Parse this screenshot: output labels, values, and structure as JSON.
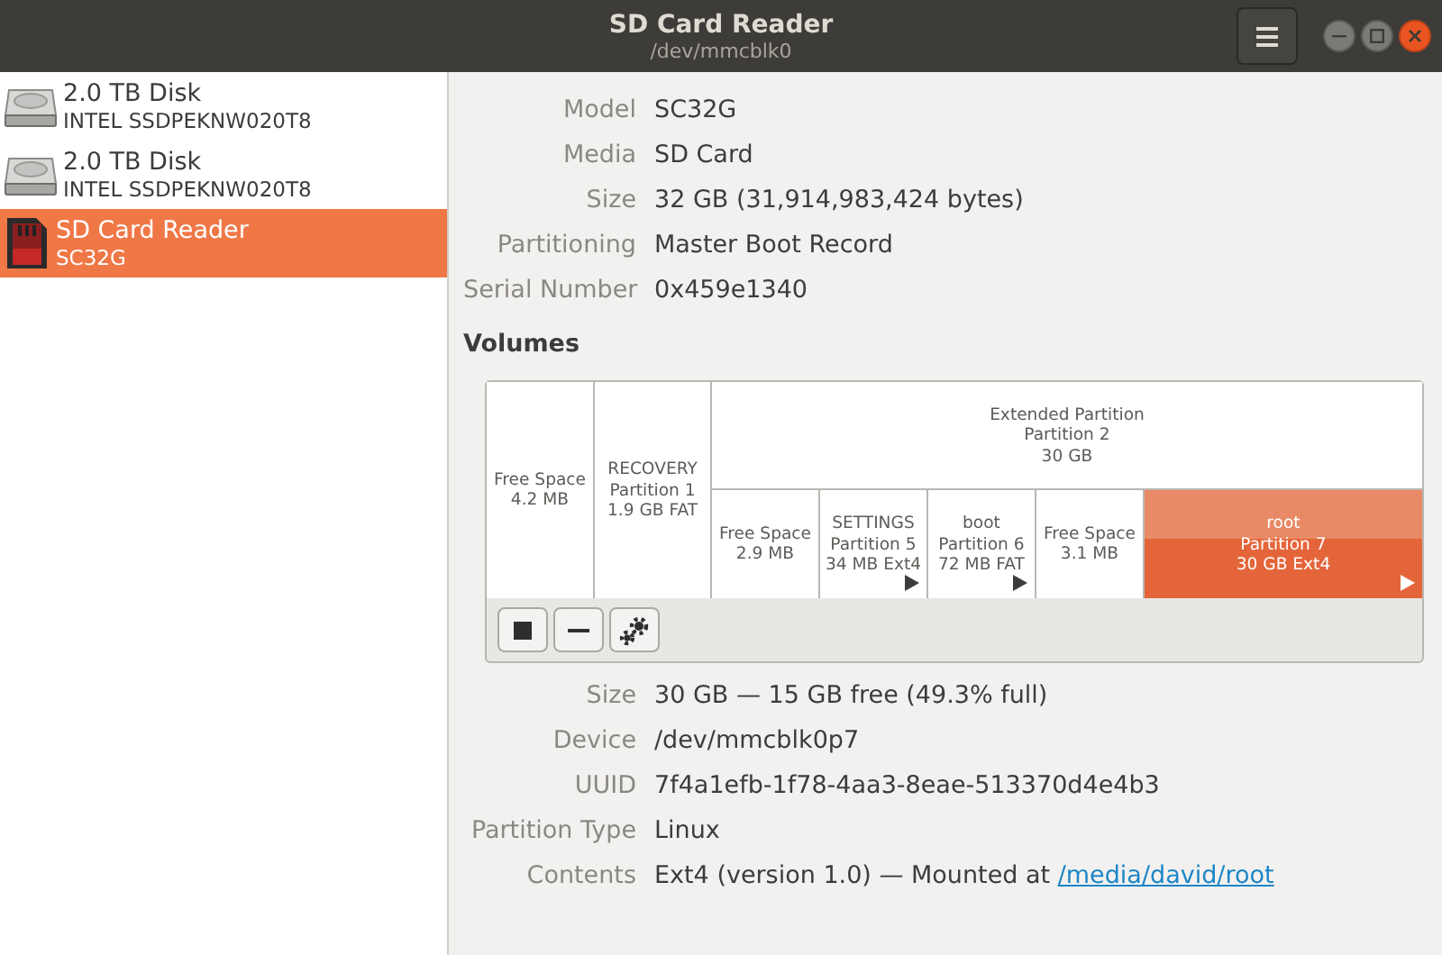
{
  "window": {
    "title": "SD Card Reader",
    "subtitle": "/dev/mmcblk0"
  },
  "drives": [
    {
      "kind": "hdd",
      "name": "2.0 TB Disk",
      "model": "INTEL SSDPEKNW020T8",
      "selected": false
    },
    {
      "kind": "hdd",
      "name": "2.0 TB Disk",
      "model": "INTEL SSDPEKNW020T8",
      "selected": false
    },
    {
      "kind": "sd",
      "name": "SD Card Reader",
      "model": "SC32G",
      "selected": true
    }
  ],
  "drive_details": [
    {
      "label": "Model",
      "value": "SC32G"
    },
    {
      "label": "Media",
      "value": "SD Card"
    },
    {
      "label": "Size",
      "value": "32 GB (31,914,983,424 bytes)"
    },
    {
      "label": "Partitioning",
      "value": "Master Boot Record"
    },
    {
      "label": "Serial Number",
      "value": "0x459e1340"
    }
  ],
  "volumes_heading": "Volumes",
  "volumes": [
    {
      "lines": [
        "Free Space",
        "4.2 MB"
      ],
      "selected": false,
      "mounted": false
    },
    {
      "lines": [
        "RECOVERY",
        "Partition 1",
        "1.9 GB FAT"
      ],
      "selected": false,
      "mounted": false
    },
    {
      "lines": [
        "Extended Partition",
        "Partition 2",
        "30 GB"
      ],
      "selected": false,
      "mounted": false,
      "children": [
        {
          "lines": [
            "Free Space",
            "2.9 MB"
          ],
          "selected": false,
          "mounted": false
        },
        {
          "lines": [
            "SETTINGS",
            "Partition 5",
            "34 MB Ext4"
          ],
          "selected": false,
          "mounted": true
        },
        {
          "lines": [
            "boot",
            "Partition 6",
            "72 MB FAT"
          ],
          "selected": false,
          "mounted": true
        },
        {
          "lines": [
            "Free Space",
            "3.1 MB"
          ],
          "selected": false,
          "mounted": false
        },
        {
          "lines": [
            "root",
            "Partition 7",
            "30 GB Ext4"
          ],
          "selected": true,
          "mounted": true
        }
      ]
    }
  ],
  "volume_toolbar": [
    {
      "kind": "stop"
    },
    {
      "kind": "remove"
    },
    {
      "kind": "settings"
    }
  ],
  "volume_details": [
    {
      "label": "Size",
      "value": "30 GB — 15 GB free (49.3% full)"
    },
    {
      "label": "Device",
      "value": "/dev/mmcblk0p7"
    },
    {
      "label": "UUID",
      "value": "7f4a1efb-1f78-4aa3-8eae-513370d4e4b3"
    },
    {
      "label": "Partition Type",
      "value": "Linux"
    },
    {
      "label": "Contents",
      "value": "Ext4 (version 1.0) — Mounted at",
      "link": "/media/david/root"
    }
  ]
}
